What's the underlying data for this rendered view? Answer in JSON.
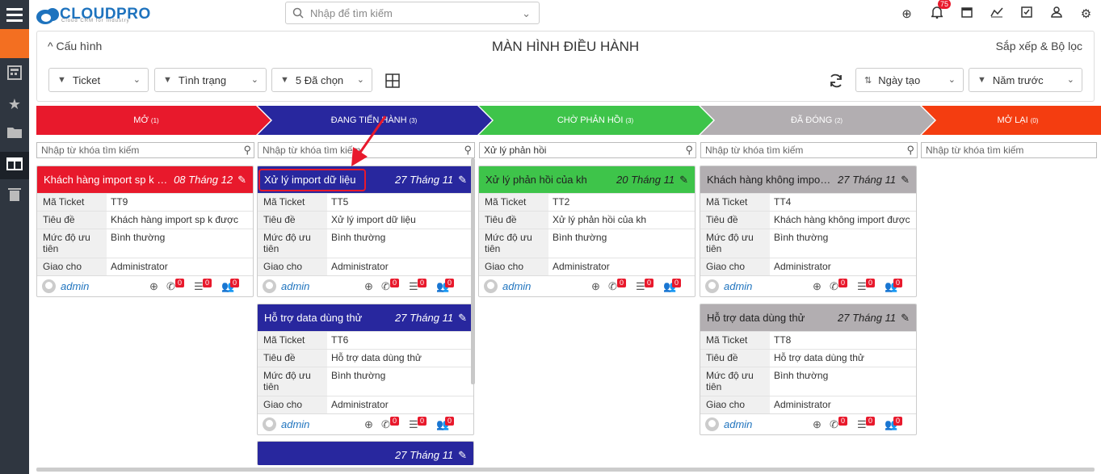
{
  "app": {
    "logo_text": "CLOUDPRO",
    "logo_sub": "Cloud CRM for Industry",
    "search_placeholder": "Nhập để tìm kiếm",
    "notification_count": "75"
  },
  "panel": {
    "config_label": "Cấu hình",
    "title": "MÀN HÌNH ĐIỀU HÀNH",
    "sort_filter_label": "Sắp xếp & Bộ lọc",
    "filters": {
      "module": "Ticket",
      "status": "Tình trạng",
      "selected": "5 Đã chọn",
      "sort": "Ngày tạo",
      "period": "Năm trước"
    }
  },
  "stages": [
    {
      "label": "MỞ",
      "count": "(1)",
      "color": "#e8192c"
    },
    {
      "label": "ĐANG TIẾN HÀNH",
      "count": "(3)",
      "color": "#28279e"
    },
    {
      "label": "CHỜ PHẢN HỒI",
      "count": "(3)",
      "color": "#3ec44a"
    },
    {
      "label": "ĐÃ ĐÓNG",
      "count": "(2)",
      "color": "#b2aeb1"
    },
    {
      "label": "MỞ LẠI",
      "count": "(0)",
      "color": "#f43d10"
    }
  ],
  "column_search": [
    {
      "placeholder": "Nhập từ khóa tìm kiếm",
      "value": ""
    },
    {
      "placeholder": "Nhập từ khóa tìm kiếm",
      "value": ""
    },
    {
      "placeholder": "",
      "value": "Xử lý phản hồi"
    },
    {
      "placeholder": "Nhập từ khóa tìm kiếm",
      "value": ""
    },
    {
      "placeholder": "Nhập từ khóa tìm kiếm",
      "value": ""
    }
  ],
  "labels": {
    "ticket_no": "Mã Ticket",
    "subject": "Tiêu đề",
    "priority": "Mức độ ưu tiên",
    "assigned": "Giao cho"
  },
  "cards": {
    "c1": {
      "title": "Khách hàng import sp k được",
      "date": "08 Tháng 12",
      "ticket_no": "TT9",
      "subject": "Khách hàng import sp k được",
      "priority": "Bình thường",
      "assigned": "Administrator",
      "user": "admin"
    },
    "c2": {
      "title": "Xử lý import dữ liệu",
      "date": "27 Tháng 11",
      "ticket_no": "TT5",
      "subject": "Xử lý import dữ liệu",
      "priority": "Bình thường",
      "assigned": "Administrator",
      "user": "admin"
    },
    "c3": {
      "title": "Hỗ trợ data dùng thử",
      "date": "27 Tháng 11",
      "ticket_no": "TT6",
      "subject": "Hỗ trợ data dùng thử",
      "priority": "Bình thường",
      "assigned": "Administrator",
      "user": "admin"
    },
    "c4": {
      "title": "",
      "date": "27 Tháng 11"
    },
    "c5": {
      "title": "Xử lý phản hồi của kh",
      "date": "20 Tháng 11",
      "ticket_no": "TT2",
      "subject": "Xử lý phản hồi của kh",
      "priority": "Bình thường",
      "assigned": "Administrator",
      "user": "admin"
    },
    "c6": {
      "title": "Khách hàng không import được",
      "date": "27 Tháng 11",
      "ticket_no": "TT4",
      "subject": "Khách hàng không import được",
      "priority": "Bình thường",
      "assigned": "Administrator",
      "user": "admin"
    },
    "c7": {
      "title": "Hỗ trợ data dùng thử",
      "date": "27 Tháng 11",
      "ticket_no": "TT8",
      "subject": "Hỗ trợ data dùng thử",
      "priority": "Bình thường",
      "assigned": "Administrator",
      "user": "admin"
    }
  },
  "counter_zero": "0",
  "icons": {
    "calls": "phone-icon",
    "tasks": "checklist-icon",
    "followers": "users-icon"
  }
}
